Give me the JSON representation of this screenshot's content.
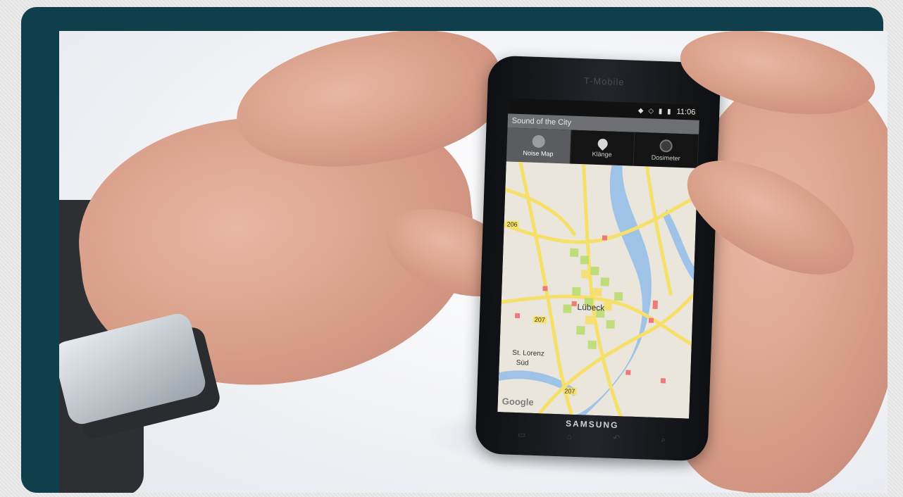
{
  "phone": {
    "carrier_text": "T-Mobile",
    "brand": "SAMSUNG",
    "status_time": "11:06",
    "app_title": "Sound of the City",
    "tabs": [
      {
        "label": "Noise Map",
        "icon": "noise-map-icon",
        "active": true
      },
      {
        "label": "Klänge",
        "icon": "location-pin-icon",
        "active": false
      },
      {
        "label": "Dosimeter",
        "icon": "dosimeter-icon",
        "active": false
      }
    ],
    "map": {
      "city_label": "Lübeck",
      "district_label_1": "St. Lorenz",
      "district_label_2": "Süd",
      "road_labels": [
        "207",
        "207",
        "206"
      ],
      "attribution": "Google"
    }
  },
  "colors": {
    "frame": "#0f3f4b",
    "map_road": "#f6e06a",
    "map_water": "#9fc3e6",
    "noise_green": "#b8dc6a",
    "noise_red": "#f07a7a"
  }
}
